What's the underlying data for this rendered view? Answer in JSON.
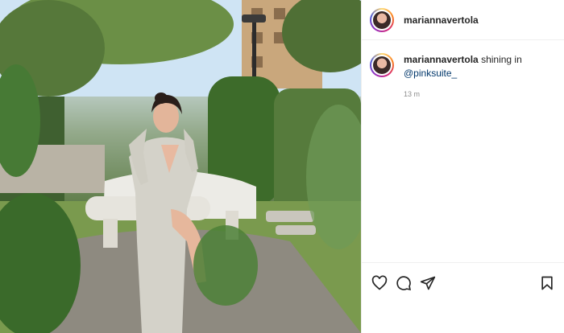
{
  "post": {
    "author": "mariannavertola",
    "caption_prefix": "shining in",
    "mention": "@pinksuite_",
    "timestamp": "13 m"
  },
  "icons": {
    "like": "heart-icon",
    "comment": "comment-icon",
    "share": "paper-plane-icon",
    "save": "bookmark-icon"
  },
  "colors": {
    "mention": "#00376b",
    "secondary_text": "#8e8e8e",
    "divider": "#efefef"
  }
}
